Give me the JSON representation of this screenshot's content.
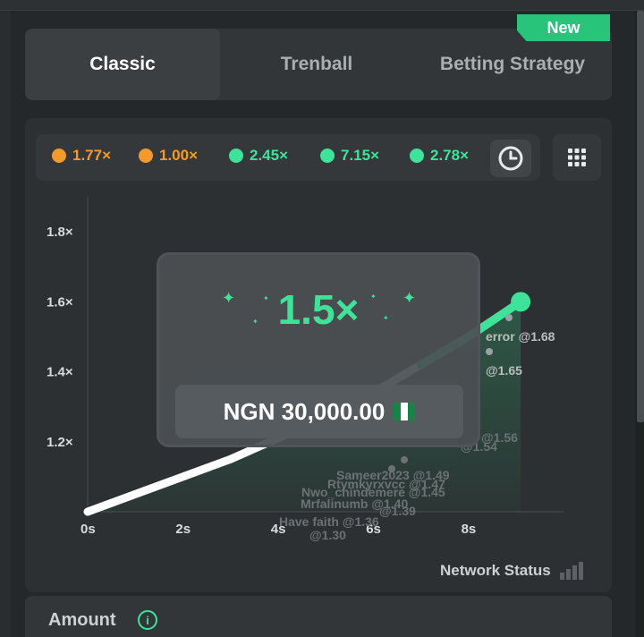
{
  "tabs": [
    {
      "label": "Classic"
    },
    {
      "label": "Trenball"
    },
    {
      "label": "Betting Strategy"
    }
  ],
  "badge": {
    "label": "New",
    "color": "#27c47a"
  },
  "history": [
    {
      "value": "1.77×",
      "color": "orange"
    },
    {
      "value": "1.00×",
      "color": "orange"
    },
    {
      "value": "2.45×",
      "color": "green"
    },
    {
      "value": "7.15×",
      "color": "green"
    },
    {
      "value": "2.78×",
      "color": "green"
    }
  ],
  "history_buttons": {
    "history_icon": "clock-icon",
    "menu_icon": "grid-dots-icon"
  },
  "chart": {
    "y_ticks": [
      "1.8×",
      "1.6×",
      "1.4×",
      "1.2×"
    ],
    "x_ticks": [
      "0s",
      "2s",
      "4s",
      "6s",
      "8s"
    ],
    "players": [
      {
        "label": "error @1.68"
      },
      {
        "label": "@1.65"
      },
      {
        "label": "@1.56"
      },
      {
        "label": "@1.54"
      },
      {
        "label": "Sameer2023 @1.49"
      },
      {
        "label": "Rtymkyrxvcc @1.47"
      },
      {
        "label": "Nwo_chindemere @1.45"
      },
      {
        "label": "Mrfalinumb @1.40"
      },
      {
        "label": "@1.39"
      },
      {
        "label": "Have faith @1.36"
      },
      {
        "label": "@1.30"
      }
    ]
  },
  "chart_data": {
    "type": "line",
    "xlabel": "",
    "ylabel": "",
    "x_ticks": [
      "0s",
      "2s",
      "4s",
      "6s",
      "8s"
    ],
    "y_ticks": [
      "1.2×",
      "1.4×",
      "1.6×",
      "1.8×"
    ],
    "ylim": [
      1.0,
      1.9
    ],
    "xlim": [
      0,
      10
    ],
    "series": [
      {
        "x": [
          0,
          1,
          2,
          3,
          4,
          5,
          6,
          7,
          8,
          9.1
        ],
        "y": [
          1.0,
          1.05,
          1.1,
          1.15,
          1.21,
          1.27,
          1.34,
          1.42,
          1.5,
          1.6
        ]
      }
    ]
  },
  "overlay": {
    "multiplier": "1.5×",
    "bet_amount": "NGN 30,000.00",
    "flag": "nigeria-flag"
  },
  "network_status": {
    "label": "Network Status",
    "icon": "signal-bars-icon"
  },
  "amount": {
    "label": "Amount",
    "info_icon": "i"
  },
  "colors": {
    "accent": "#3ee39a",
    "orange": "#f39a2b",
    "background": "#25282a"
  }
}
